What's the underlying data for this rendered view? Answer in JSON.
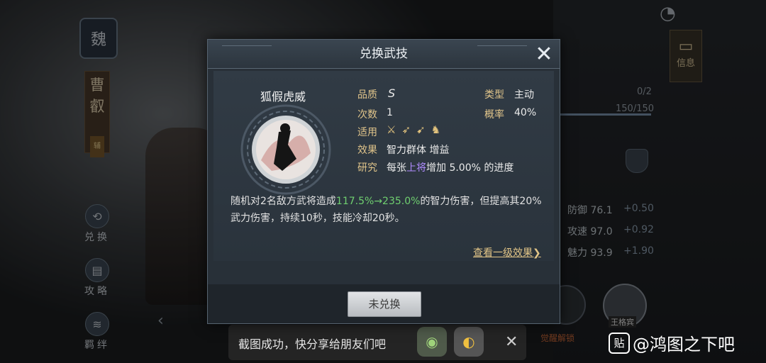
{
  "background": {
    "kingdom": "魏",
    "hero_name": "曹叡",
    "hero_tag": "辅",
    "side_buttons": [
      {
        "label": "兑换",
        "icon": "exchange-icon"
      },
      {
        "label": "攻略",
        "icon": "book-icon"
      },
      {
        "label": "羁绊",
        "icon": "scroll-icon"
      }
    ],
    "info_tab": "信息",
    "exp_count": "0/2",
    "level_progress": "150/150",
    "stats": [
      {
        "label": "防御",
        "value": "76.1",
        "bonus": "+0.50"
      },
      {
        "label": "攻速",
        "value": "97.0",
        "bonus": "+0.92"
      },
      {
        "label": "魅力",
        "value": "93.9",
        "bonus": "+1.90"
      }
    ],
    "unlock_label": "觉醒解锁",
    "avatar_caption": "王格宾"
  },
  "share": {
    "text": "截图成功，快分享给朋友们吧",
    "wechat_icon": "wechat-icon",
    "app_icon": "app-icon"
  },
  "watermark": {
    "logo": "贴",
    "text": "@鸿图之下吧"
  },
  "modal": {
    "title": "兑换武技",
    "skill": {
      "name": "狐假虎威",
      "grade_label": "品质",
      "grade": "S",
      "type_label": "类型",
      "type": "主动",
      "uses_label": "次数",
      "uses": "1",
      "chance_label": "概率",
      "chance": "40%",
      "apply_label": "适用",
      "weapons": [
        "sword-icon",
        "bow-icon",
        "spear-icon",
        "horse-icon"
      ],
      "effect_label": "效果",
      "effect": "智力群体 增益",
      "research_label": "研究",
      "research_pre": "每张",
      "research_highlight": "上将",
      "research_post": "增加 5.00% 的进度",
      "desc_pre": "随机对2名敌方武将造成",
      "desc_low": "117.5%",
      "desc_arrow": "→",
      "desc_high": "235.0%",
      "desc_post": "的智力伤害，但提高其20%武力伤害，持续10秒，技能冷却20秒。"
    },
    "more_link": "查看一级效果❯",
    "button": "未兑换"
  }
}
